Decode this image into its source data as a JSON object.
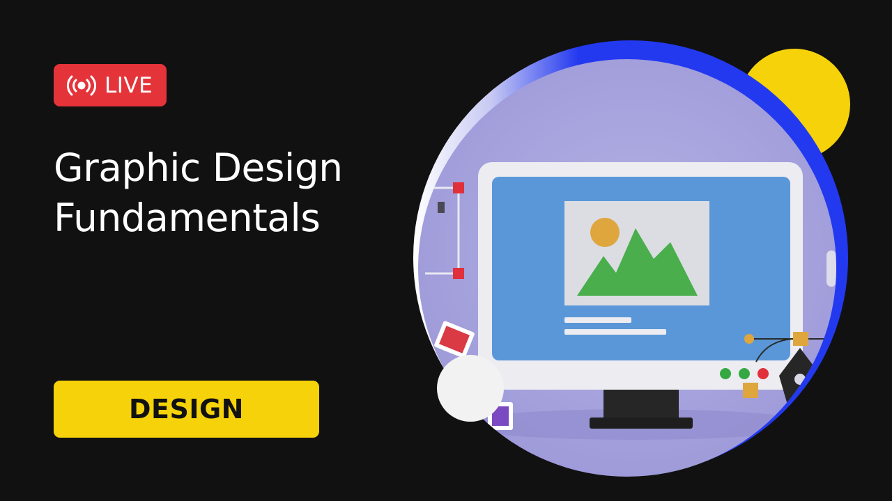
{
  "badge": {
    "icon": "broadcast-icon",
    "label": "LIVE",
    "color": "#e5333a"
  },
  "title": {
    "line1": "Graphic Design",
    "line2": "Fundamentals"
  },
  "category": {
    "label": "DESIGN",
    "color": "#f5d20a"
  },
  "colors": {
    "background": "#111111",
    "accent_blue": "#2339f0",
    "accent_yellow": "#f5d20a",
    "lavender": "#a7a4da"
  },
  "illustration": {
    "icon": "computer-monitor-icon"
  }
}
